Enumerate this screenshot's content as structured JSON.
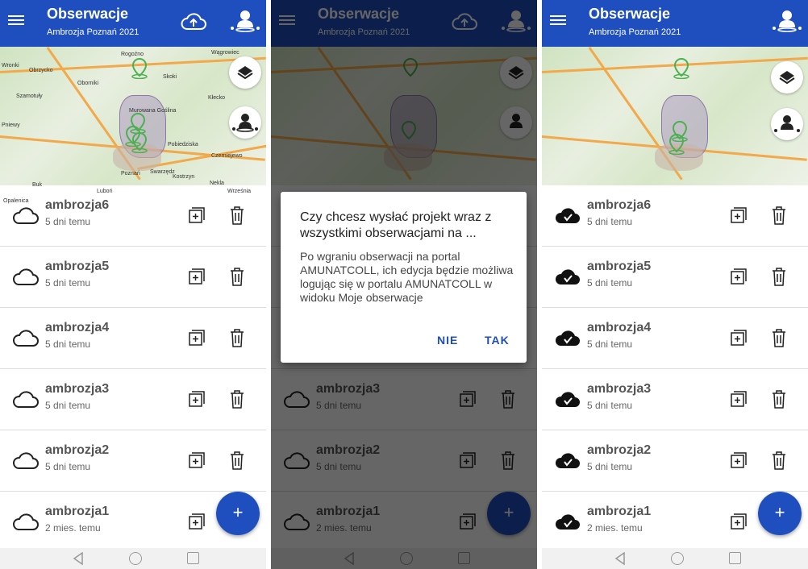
{
  "app": {
    "title": "Obserwacje",
    "subtitle": "Ambrozja Poznań 2021"
  },
  "map": {
    "labels": [
      "Rogoźno",
      "Wągrowiec",
      "Obrzycko",
      "Oborniki",
      "Skoki",
      "Szamotuły",
      "Murowana Goślina",
      "Kłecko",
      "Pobiedziska",
      "Poznań",
      "Swarzędz",
      "Kostrzyn",
      "Czerniejewo",
      "Buk",
      "Luboń",
      "Nekla",
      "Września",
      "Opalenica",
      "Pniewy",
      "Wronki"
    ],
    "layers_button_icon": "layers-icon",
    "location_button_icon": "user-location-icon"
  },
  "observations": [
    {
      "name": "ambrozja6",
      "time": "5 dni temu"
    },
    {
      "name": "ambrozja5",
      "time": "5 dni temu"
    },
    {
      "name": "ambrozja4",
      "time": "5 dni temu"
    },
    {
      "name": "ambrozja3",
      "time": "5 dni temu"
    },
    {
      "name": "ambrozja2",
      "time": "5 dni temu"
    },
    {
      "name": "ambrozja1",
      "time": "2 mies. temu"
    }
  ],
  "fab": {
    "label": "+"
  },
  "dialog": {
    "title": "Czy chcesz wysłać projekt wraz z wszystkimi obserwacjami na ...",
    "body": "Po wgraniu obserwacji na portal AMUNATCOLL, ich edycja będzie możliwa logując się w portalu AMUNATCOLL w widoku Moje obserwacje",
    "no_label": "NIE",
    "yes_label": "TAK"
  },
  "colors": {
    "primary": "#1f4fbf",
    "scrim": "rgba(0,0,0,0.6)"
  }
}
